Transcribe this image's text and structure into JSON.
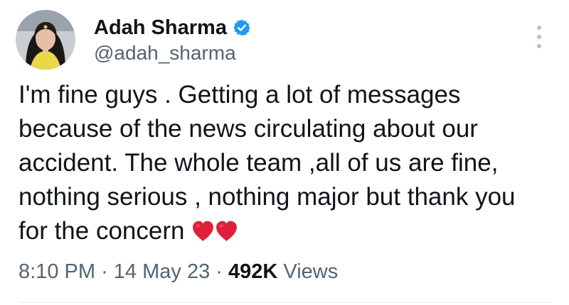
{
  "author": {
    "display_name": "Adah Sharma",
    "handle": "@adah_sharma",
    "verified": true,
    "avatar_icon": "profile-photo"
  },
  "tweet": {
    "text": "I'm fine guys . Getting a lot of messages because of the news circulating about our accident. The whole team ,all of us are fine, nothing serious , nothing major but thank you for the concern",
    "emoji": [
      "red-heart",
      "red-heart"
    ]
  },
  "meta": {
    "time": "8:10 PM",
    "separator": "·",
    "date": "14 May 23",
    "views_count": "492K",
    "views_label": "Views"
  },
  "more_icon": "more-vertical-icon",
  "colors": {
    "text_primary": "#0f1419",
    "text_secondary": "#536471",
    "verified_blue": "#1d9bf0",
    "heart_red": "#e0203a",
    "divider": "#e6ebee"
  }
}
